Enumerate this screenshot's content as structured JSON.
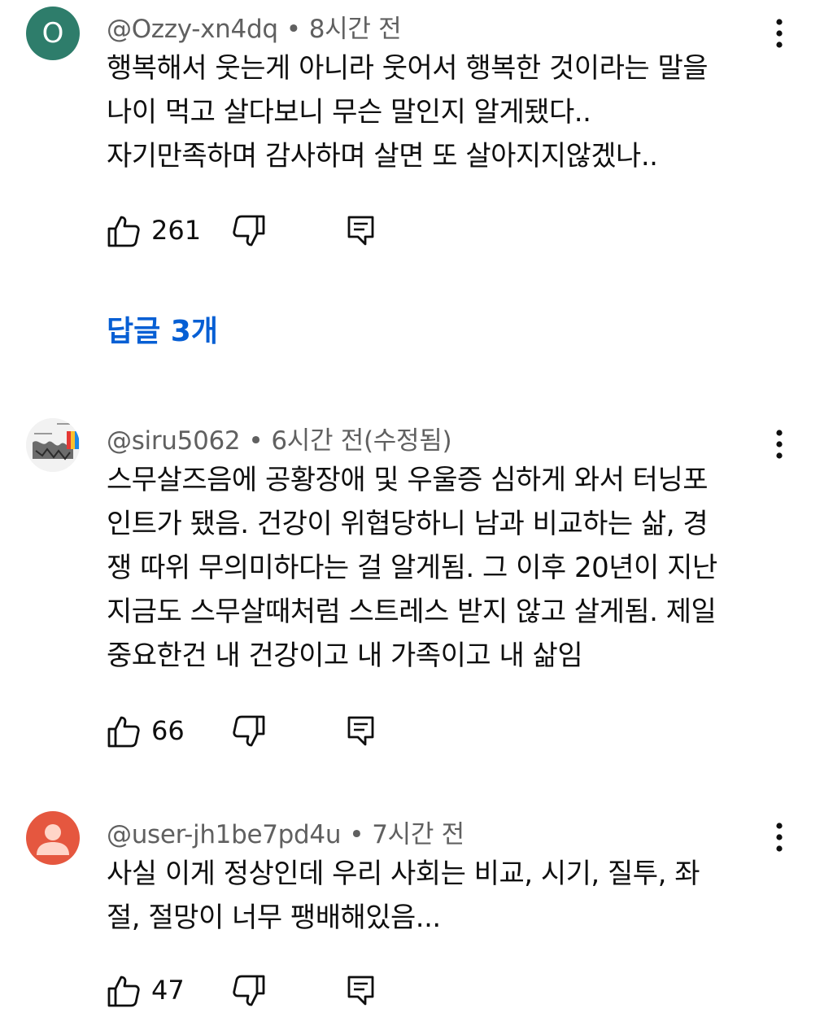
{
  "comments": [
    {
      "avatar_letter": "O",
      "author": "@Ozzy-xn4dq",
      "time": "8시간 전",
      "lines": [
        "행복해서 웃는게 아니라 웃어서 행복한 것이라는 말을",
        "나이 먹고 살다보니 무슨 말인지 알게됐다..",
        "자기만족하며 감사하며 살면 또 살아지지않겠나.."
      ],
      "likes": "261",
      "replies_label": "답글 3개"
    },
    {
      "author": "@siru5062",
      "time": "6시간 전(수정됨)",
      "lines": [
        "스무살즈음에 공황장애 및 우울증 심하게 와서 터닝포",
        "인트가 됐음. 건강이 위협당하니 남과 비교하는 삶, 경",
        "쟁 따위 무의미하다는 걸 알게됨. 그 이후 20년이 지난",
        "지금도 스무살때처럼 스트레스 받지 않고 살게됨. 제일",
        "중요한건 내 건강이고 내 가족이고 내 삶임"
      ],
      "likes": "66"
    },
    {
      "author": "@user-jh1be7pd4u",
      "time": "7시간 전",
      "lines": [
        "사실 이게 정상인데 우리 사회는 비교, 시기, 질투, 좌",
        "절, 절망이 너무 팽배해있음..."
      ],
      "likes": "47"
    }
  ],
  "separator": "•",
  "colors": {
    "link_blue": "#065fd4",
    "meta_gray": "#606060",
    "avatar_green": "#2e7d6b",
    "avatar_orange": "#e5573f"
  },
  "icons": [
    "more-vert-icon",
    "thumb-up-icon",
    "thumb-down-icon",
    "reply-icon"
  ]
}
